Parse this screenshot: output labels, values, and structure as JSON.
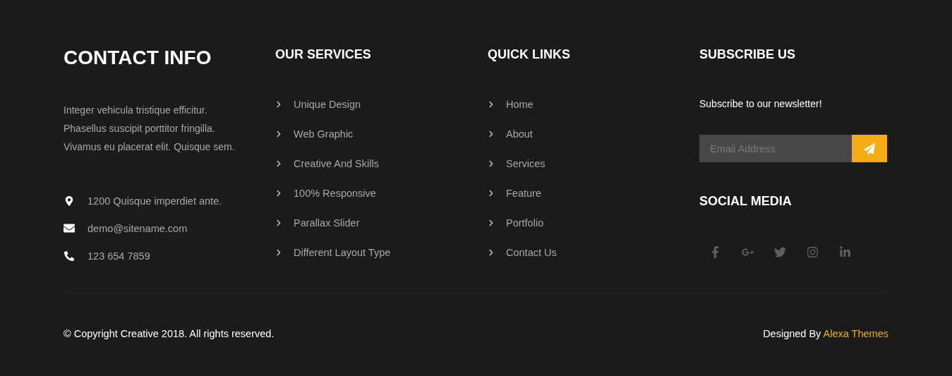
{
  "contact": {
    "title": "CONTACT INFO",
    "about": "Integer vehicula tristique efficitur. Phasellus suscipit porttitor fringilla. Vivamus eu placerat elit. Quisque sem.",
    "items": [
      {
        "kind": "address",
        "text": "1200 Quisque imperdiet ante."
      },
      {
        "kind": "email",
        "text": "demo@sitename.com"
      },
      {
        "kind": "phone",
        "text": "123 654 7859"
      }
    ]
  },
  "services": {
    "title": "OUR SERVICES",
    "links": [
      "Unique Design",
      "Web Graphic",
      "Creative And Skills",
      "100% Responsive",
      "Parallax Slider",
      "Different Layout Type"
    ]
  },
  "quick_links": {
    "title": "QUICK LINKS",
    "links": [
      "Home",
      "About",
      "Services",
      "Feature",
      "Portfolio",
      "Contact Us"
    ]
  },
  "subscribe": {
    "title": "SUBSCRIBE US",
    "text": "Subscribe to our newsletter!",
    "placeholder": "Email Address"
  },
  "social": {
    "title": "SOCIAL MEDIA",
    "links": [
      {
        "kind": "facebook"
      },
      {
        "kind": "google-plus"
      },
      {
        "kind": "twitter"
      },
      {
        "kind": "instagram"
      },
      {
        "kind": "linkedin"
      }
    ]
  },
  "bottom": {
    "copyright": "© Copyright Creative 2018. All rights reserved.",
    "designed_by": "Designed By",
    "designer": "Alexa Themes"
  }
}
